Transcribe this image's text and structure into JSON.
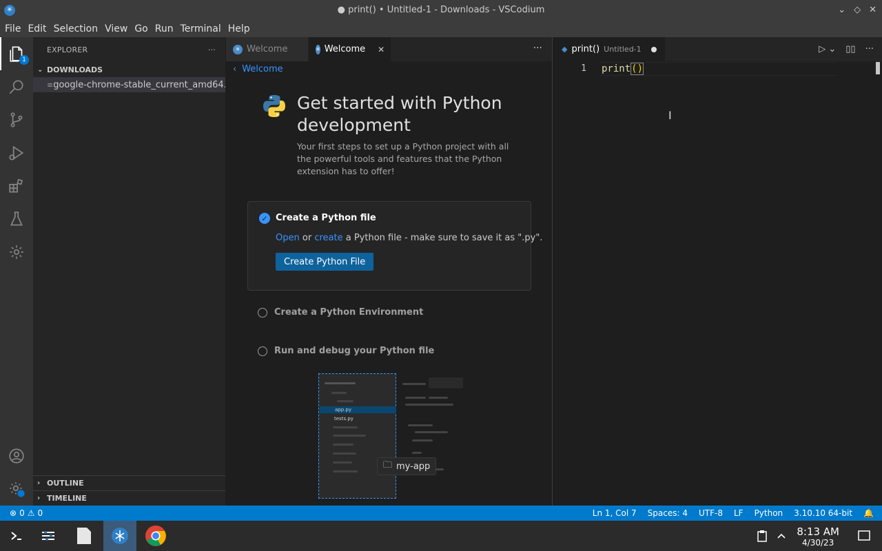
{
  "window": {
    "title": "● print() • Untitled-1 - Downloads - VSCodium"
  },
  "menu": [
    "File",
    "Edit",
    "Selection",
    "View",
    "Go",
    "Run",
    "Terminal",
    "Help"
  ],
  "activity_bar": {
    "explorer_badge": "1"
  },
  "sidebar": {
    "title": "EXPLORER",
    "more": "···",
    "folder": "DOWNLOADS",
    "file": "google-chrome-stable_current_amd64....",
    "outline": "OUTLINE",
    "timeline": "TIMELINE"
  },
  "left_group": {
    "tabs": [
      {
        "label": "Welcome"
      },
      {
        "label": "Welcome"
      }
    ],
    "more": "···",
    "breadcrumb": "Welcome",
    "walkthrough": {
      "title": "Get started with Python development",
      "subtitle": "Your first steps to set up a Python project with all the powerful tools and features that the Python extension has to offer!",
      "active_step": {
        "title": "Create a Python file",
        "desc_link1": "Open",
        "desc_mid": " or ",
        "desc_link2": "create",
        "desc_rest": " a Python file - make sure to save it as \".py\".",
        "button": "Create Python File"
      },
      "steps": [
        "Create a Python Environment",
        "Run and debug your Python file"
      ],
      "preview": {
        "files": [
          "app.py",
          "tests.py"
        ],
        "folder_label": "my-app"
      }
    }
  },
  "right_group": {
    "tab_label": "print()",
    "tab_sub": "Untitled-1",
    "line_number": "1",
    "code_fn": "print",
    "code_parens": "()"
  },
  "statusbar": {
    "errors": "0",
    "warnings": "0",
    "position": "Ln 1, Col 7",
    "spaces": "Spaces: 4",
    "encoding": "UTF-8",
    "eol": "LF",
    "language": "Python",
    "interpreter": "3.10.10 64-bit"
  },
  "taskbar": {
    "time": "8:13 AM",
    "date": "4/30/23"
  },
  "colors": {
    "accent": "#007acc",
    "link": "#3794ff",
    "button": "#0e639c"
  }
}
